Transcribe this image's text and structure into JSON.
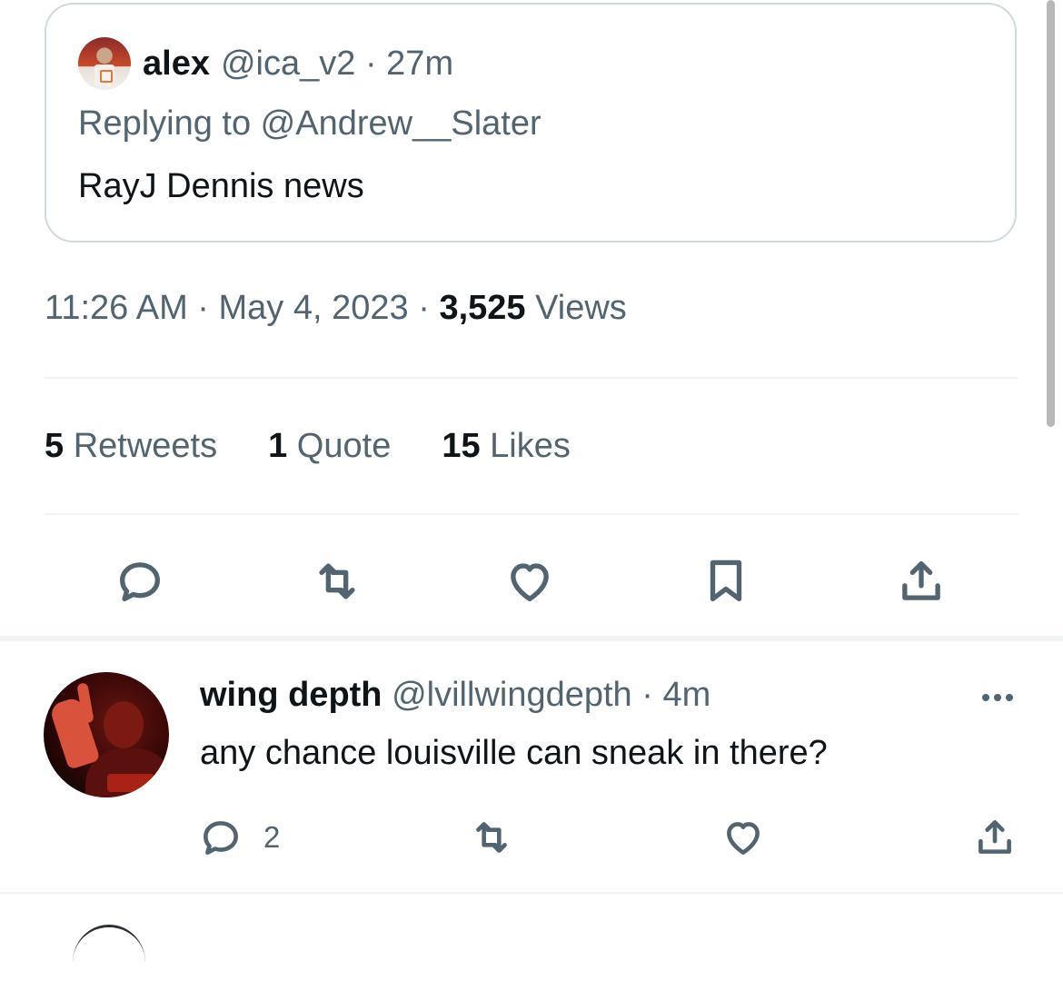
{
  "quoted_tweet": {
    "author_name": "alex",
    "author_handle": "@ica_v2",
    "separator": "·",
    "time_ago": "27m",
    "replying_to_label": "Replying to ",
    "replying_to_handle": "@Andrew__Slater",
    "text": "RayJ Dennis news"
  },
  "tweet_meta": {
    "time": "11:26 AM",
    "separator": "·",
    "date": "May 4, 2023",
    "views_count": "3,525",
    "views_label": " Views"
  },
  "stats": [
    {
      "count": "5",
      "label": " Retweets"
    },
    {
      "count": "1",
      "label": " Quote"
    },
    {
      "count": "15",
      "label": " Likes"
    }
  ],
  "actions": [
    {
      "icon": "reply-icon"
    },
    {
      "icon": "retweet-icon"
    },
    {
      "icon": "like-icon"
    },
    {
      "icon": "bookmark-icon"
    },
    {
      "icon": "share-icon"
    }
  ],
  "reply": {
    "author_name": "wing depth",
    "author_handle": "@lvillwingdepth",
    "separator": "·",
    "time_ago": "4m",
    "text": "any chance louisville can sneak in there?",
    "reply_count": "2"
  },
  "colors": {
    "text_primary": "#0f1419",
    "text_secondary": "#536471",
    "border": "#cfd9de",
    "divider": "#eff3f4"
  }
}
